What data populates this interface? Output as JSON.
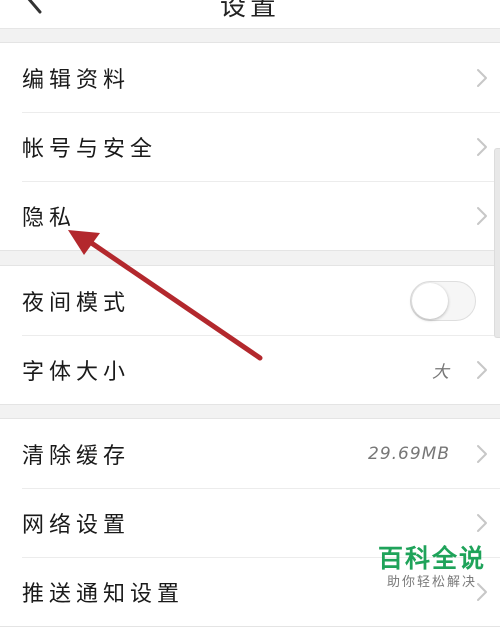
{
  "header": {
    "title": "设置",
    "back_icon": "chevron-left-icon"
  },
  "groups": [
    {
      "items": [
        {
          "label": "编辑资料",
          "icon": "chevron-right-icon"
        },
        {
          "label": "帐号与安全",
          "icon": "chevron-right-icon"
        },
        {
          "label": "隐私",
          "icon": "chevron-right-icon"
        }
      ]
    },
    {
      "items": [
        {
          "label": "夜间模式",
          "toggle_on": false
        },
        {
          "label": "字体大小",
          "value": "大",
          "icon": "chevron-right-icon"
        }
      ]
    },
    {
      "items": [
        {
          "label": "清除缓存",
          "value": "29.69MB",
          "icon": "chevron-right-icon"
        },
        {
          "label": "网络设置",
          "icon": "chevron-right-icon"
        },
        {
          "label": "推送通知设置",
          "icon": "chevron-right-icon"
        }
      ]
    }
  ],
  "annotation": {
    "type": "arrow",
    "color": "#b3282d"
  },
  "watermark": {
    "title": "百科全说",
    "subtitle": "助你轻松解决"
  },
  "colors": {
    "background": "#f2f2f2",
    "row": "#ffffff",
    "text": "#1a1a1a",
    "chevron": "#c7c7c7",
    "watermark": "#1fa35a"
  }
}
